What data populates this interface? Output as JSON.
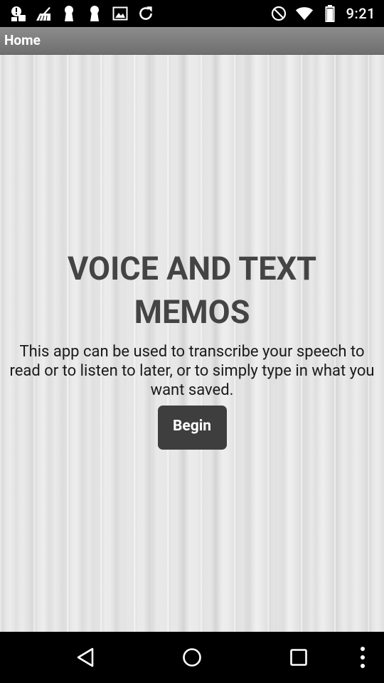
{
  "status_bar": {
    "time": "9:21",
    "left_icons": [
      "notification-alert-icon",
      "broom-icon",
      "keyhole-icon",
      "keyhole-icon",
      "image-icon",
      "sync-icon"
    ],
    "right_icons": [
      "do-not-disturb-icon",
      "wifi-icon",
      "battery-icon"
    ]
  },
  "action_bar": {
    "title": "Home"
  },
  "main": {
    "title": "VOICE AND TEXT MEMOS",
    "description": "This app can be used to transcribe your speech to read or to listen to later, or to simply type in what you want saved.",
    "begin_button_label": "Begin"
  },
  "nav_bar": {
    "buttons": [
      "back-icon",
      "home-icon",
      "recents-icon",
      "overflow-menu-icon"
    ]
  }
}
